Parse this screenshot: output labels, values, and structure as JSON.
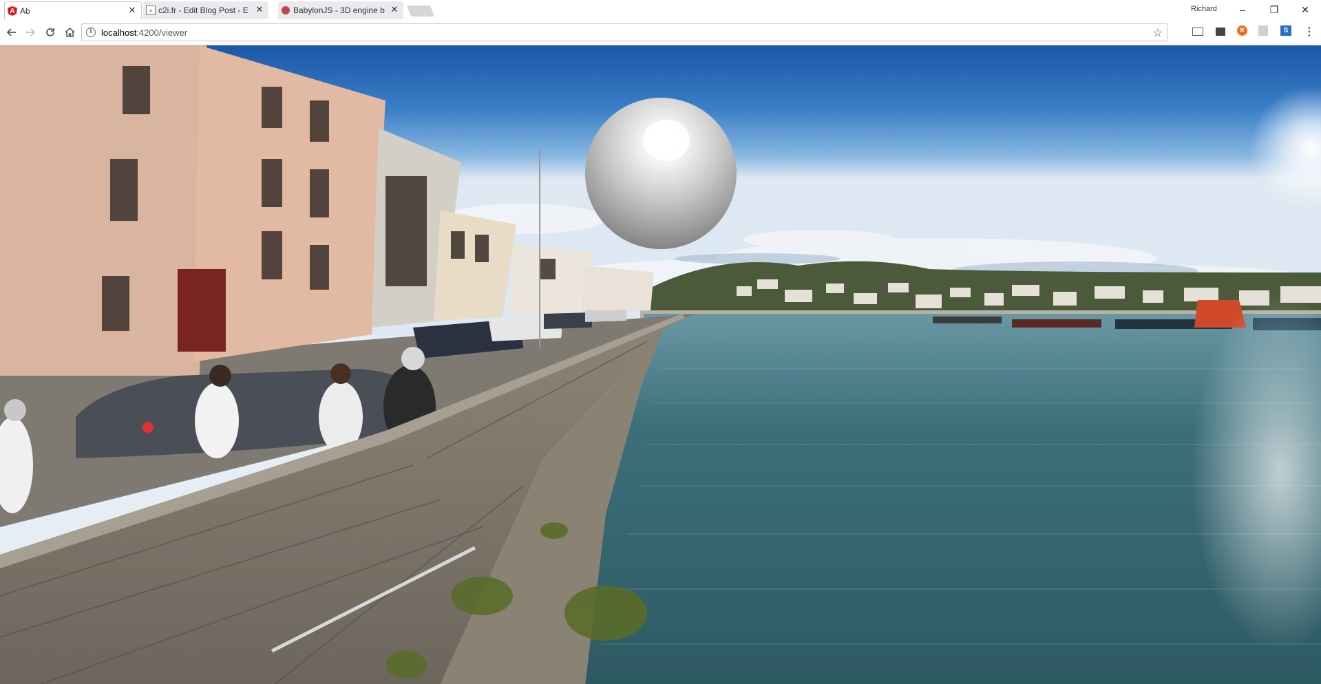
{
  "browser": {
    "tabs": [
      {
        "title": "Ab",
        "active": true,
        "favicon": "angular-icon"
      },
      {
        "title": "c2i.fr - Edit Blog Post - E",
        "active": false,
        "favicon": "document-icon"
      },
      {
        "title": "BabylonJS - 3D engine b",
        "active": false,
        "favicon": "babylonjs-icon"
      }
    ],
    "profile_name": "Richard",
    "window_controls": {
      "minimize": "–",
      "restore": "❐",
      "close": "✕"
    },
    "url_host": "localhost",
    "url_path": ":4200/viewer"
  },
  "viewer": {
    "scene": "360 panorama of harbour quay with buildings, parked cars and water",
    "sphere_color": "#d8d8d8"
  },
  "colors": {
    "angular_red": "#dd1b16",
    "sky_top": "#1f5fae",
    "water": "#3c6f7a"
  }
}
